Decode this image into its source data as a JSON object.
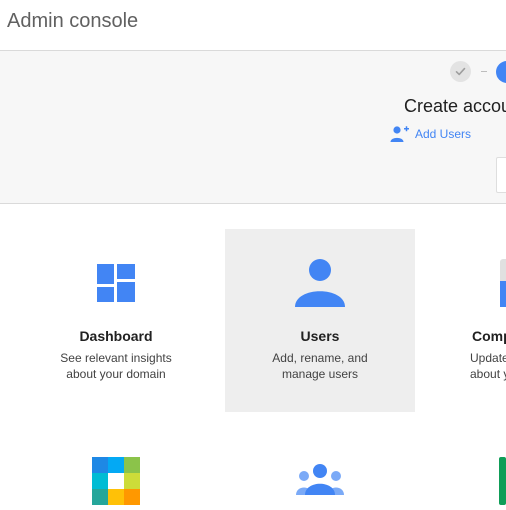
{
  "app": {
    "title": "Admin console"
  },
  "setup": {
    "title": "Create accou",
    "add_users_label": "Add Users"
  },
  "tiles": [
    {
      "name": "Dashboard",
      "desc_line1": "See relevant insights",
      "desc_line2": "about your domain",
      "icon": "dashboard-icon"
    },
    {
      "name": "Users",
      "desc_line1": "Add, rename, and",
      "desc_line2": "manage users",
      "icon": "user-icon"
    },
    {
      "name": "Comp",
      "desc_line1": "Update",
      "desc_line2": "about y",
      "icon": "company-profile-icon"
    }
  ],
  "row2_icons": [
    "apps-icon",
    "groups-icon",
    "devices-icon"
  ],
  "colors": {
    "accent": "#4285f4",
    "active_tile_bg": "#eeeeee",
    "setup_bg": "#f7f7f7"
  }
}
